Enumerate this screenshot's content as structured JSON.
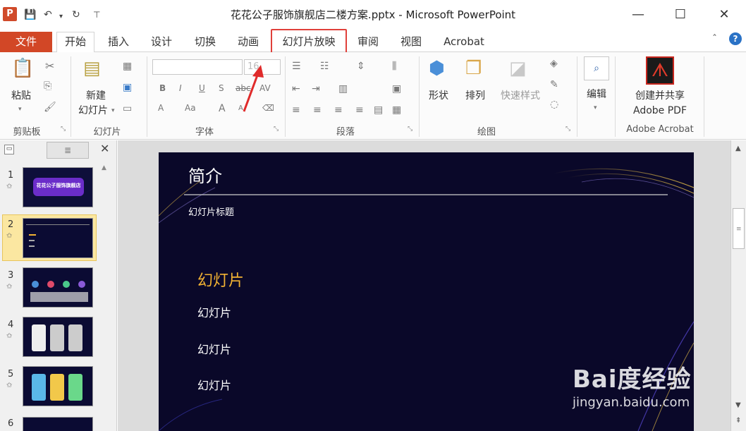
{
  "window": {
    "title": "花花公子服饰旗舰店二楼方案.pptx - Microsoft PowerPoint",
    "app_icon_letter": "P",
    "controls": {
      "minimize": "—",
      "maximize": "☐",
      "close": "✕"
    }
  },
  "quick_access": {
    "save": "💾",
    "undo": "↶",
    "undo_dd": "▾",
    "redo": "↻",
    "customize": "⊤"
  },
  "tabs": [
    {
      "label": "文件"
    },
    {
      "label": "开始"
    },
    {
      "label": "插入"
    },
    {
      "label": "设计"
    },
    {
      "label": "切换"
    },
    {
      "label": "动画"
    },
    {
      "label": "幻灯片放映"
    },
    {
      "label": "审阅"
    },
    {
      "label": "视图"
    },
    {
      "label": "Acrobat"
    }
  ],
  "tabbar_right": {
    "collapse": "ˆ",
    "help": "?"
  },
  "ribbon": {
    "clipboard": {
      "paste": "粘贴",
      "paste_arrow": "▾",
      "group": "剪贴板"
    },
    "slides": {
      "new_line1": "新建",
      "new_line2": "幻灯片",
      "new_arrow": "▾",
      "group": "幻灯片"
    },
    "font": {
      "size_value": "16",
      "group": "字体",
      "buttons": [
        "B",
        "I",
        "U",
        "S",
        "abc",
        "AV"
      ],
      "buttons2": [
        "A",
        "Aa",
        "A",
        "A"
      ]
    },
    "paragraph": {
      "group": "段落"
    },
    "drawing": {
      "shapes": "形状",
      "arrange": "排列",
      "quick_styles": "快速样式",
      "group": "绘图"
    },
    "editing": {
      "label": "编辑",
      "arrow": "▾"
    },
    "acrobat": {
      "create_line1": "创建并共享",
      "create_line2": "Adobe PDF",
      "group": "Adobe Acrobat"
    }
  },
  "thumbnails": [
    {
      "num": "1",
      "star": "✩",
      "title": "花花公子服饰旗舰店"
    },
    {
      "num": "2",
      "star": "✩",
      "title": ""
    },
    {
      "num": "3",
      "star": "✩",
      "title": ""
    },
    {
      "num": "4",
      "star": "✩",
      "title": ""
    },
    {
      "num": "5",
      "star": "✩",
      "title": ""
    },
    {
      "num": "6",
      "star": "",
      "title": ""
    }
  ],
  "pane_close": "✕",
  "slide": {
    "title": "简介",
    "subtitle": "幻灯片标题",
    "heading": "幻灯片",
    "items": [
      "幻灯片",
      "幻灯片",
      "幻灯片"
    ]
  },
  "watermark": {
    "logo": "Bai度经验",
    "url": "jingyan.baidu.com"
  },
  "colors": {
    "accent_file_tab": "#d24726",
    "highlight": "#e0403a",
    "slide_bg": "#0a0829",
    "heading_gold": "#f2b233"
  }
}
